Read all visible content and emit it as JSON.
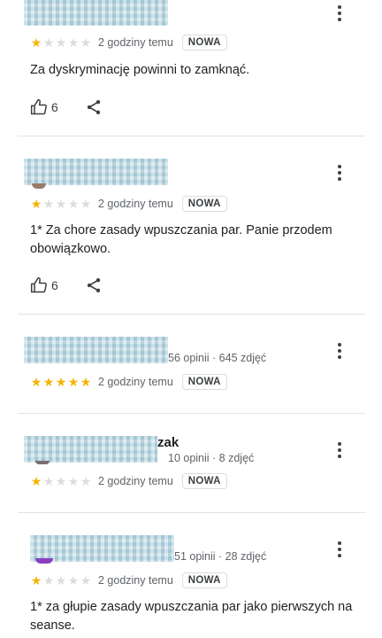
{
  "colors": {
    "star_filled": "#f4b400",
    "star_empty": "#dadce0",
    "divider": "#e3e3e3"
  },
  "icons": {
    "menu": "more-vert-icon",
    "like": "thumb-up-icon",
    "share": "share-icon",
    "star": "star-icon"
  },
  "reviews": [
    {
      "name_suffix": "",
      "meta": "",
      "rating": 1,
      "time": "2 godziny temu",
      "badge": "NOWA",
      "text": "Za dyskryminację powinni to zamknąć.",
      "likes": "6"
    },
    {
      "name_suffix": "",
      "meta": "",
      "rating": 1,
      "time": "2 godziny temu",
      "badge": "NOWA",
      "text": "1* Za chore zasady wpuszczania par. Panie przodem obowiązkowo.",
      "likes": "6"
    },
    {
      "name_suffix": "",
      "meta": "56 opinii · 645 zdjęć",
      "rating": 5,
      "time": "2 godziny temu",
      "badge": "NOWA",
      "text": "",
      "likes": ""
    },
    {
      "name_suffix": "zak",
      "meta": "10 opinii · 8 zdjęć",
      "rating": 1,
      "time": "2 godziny temu",
      "badge": "NOWA",
      "text": "",
      "likes": ""
    },
    {
      "name_suffix": "",
      "meta": "51 opinii · 28 zdjęć",
      "rating": 1,
      "time": "2 godziny temu",
      "badge": "NOWA",
      "text": "1* za głupie zasady wpuszczania par jako pierwszych na seanse.",
      "likes": ""
    }
  ]
}
